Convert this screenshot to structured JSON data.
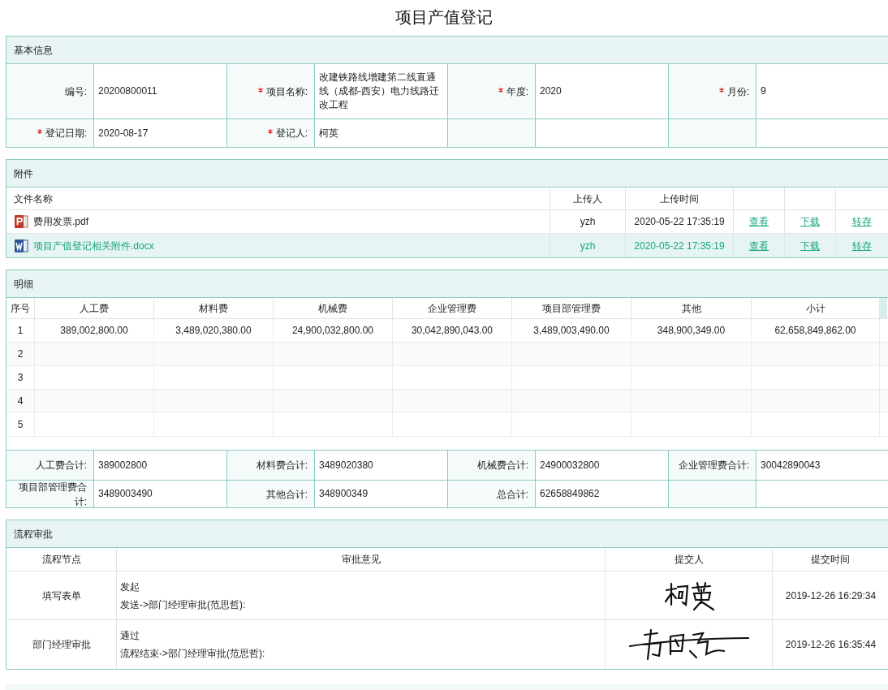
{
  "title": "项目产值登记",
  "basic_info": {
    "header": "基本信息",
    "fields": [
      {
        "label": "编号:",
        "value": "20200800011",
        "required": false
      },
      {
        "label": "项目名称:",
        "value": "改建铁路线增建第二线直通线（成都-西安）电力线路迁改工程",
        "required": true
      },
      {
        "label": "年度:",
        "value": "2020",
        "required": true
      },
      {
        "label": "月份:",
        "value": "9",
        "required": true
      },
      {
        "label": "登记日期:",
        "value": "2020-08-17",
        "required": true
      },
      {
        "label": "登记人:",
        "value": "柯英",
        "required": true
      }
    ]
  },
  "attachments": {
    "header": "附件",
    "columns": [
      "文件名称",
      "上传人",
      "上传时间"
    ],
    "rows": [
      {
        "kind": "pdf",
        "name": "费用发票.pdf",
        "uploader": "yzh",
        "time": "2020-05-22 17:35:19",
        "actions": [
          "查看",
          "下载",
          "转存"
        ],
        "selected": false
      },
      {
        "kind": "docx",
        "name": "项目产值登记相关附件.docx",
        "uploader": "yzh",
        "time": "2020-05-22 17:35:19",
        "actions": [
          "查看",
          "下载",
          "转存"
        ],
        "selected": true
      }
    ]
  },
  "details": {
    "header": "明细",
    "columns": [
      "序号",
      "人工费",
      "材料费",
      "机械费",
      "企业管理费",
      "项目部管理费",
      "其他",
      "小计"
    ],
    "rows": [
      {
        "index": "1",
        "cells": [
          "389,002,800.00",
          "3,489,020,380.00",
          "24,900,032,800.00",
          "30,042,890,043.00",
          "3,489,003,490.00",
          "348,900,349.00",
          "62,658,849,862.00"
        ]
      },
      {
        "index": "2"
      },
      {
        "index": "3"
      },
      {
        "index": "4"
      },
      {
        "index": "5"
      }
    ],
    "totals": [
      {
        "label": "人工费合计:",
        "value": "389002800"
      },
      {
        "label": "材料费合计:",
        "value": "3489020380"
      },
      {
        "label": "机械费合计:",
        "value": "24900032800"
      },
      {
        "label": "企业管理费合计:",
        "value": "30042890043"
      },
      {
        "label": "项目部管理费合计:",
        "value": "3489003490"
      },
      {
        "label": "其他合计:",
        "value": "348900349"
      },
      {
        "label": "总合计:",
        "value": "62658849862"
      }
    ]
  },
  "approval": {
    "header": "流程审批",
    "columns": [
      "流程节点",
      "审批意见",
      "提交人",
      "提交时间"
    ],
    "rows": [
      {
        "node": "填写表单",
        "opinion": [
          "发起",
          "发送->部门经理审批(范思哲):"
        ],
        "time": "2019-12-26 16:29:34"
      },
      {
        "node": "部门经理审批",
        "opinion": [
          "通过",
          "流程结束->部门经理审批(范思哲):"
        ],
        "time": "2019-12-26 16:35:44"
      }
    ]
  }
}
